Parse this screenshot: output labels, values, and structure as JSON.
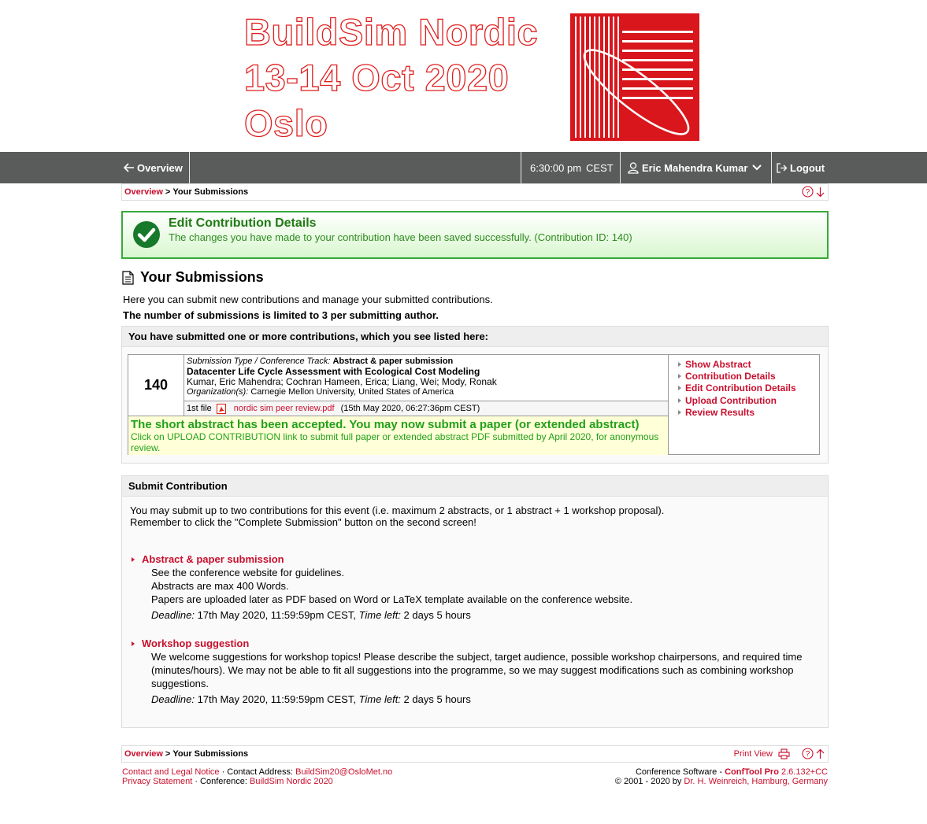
{
  "banner": {
    "lines": [
      "BuildSim Nordic",
      "13-14 Oct 2020",
      "Oslo"
    ]
  },
  "nav": {
    "overview": "Overview",
    "time": "6:30:00 pm",
    "tz": "CEST",
    "user": "Eric Mahendra Kumar",
    "logout": "Logout"
  },
  "breadcrumb": {
    "home": "Overview",
    "sep": ">",
    "current": "Your Submissions"
  },
  "success": {
    "title": "Edit Contribution Details",
    "message": "The changes you have made to your contribution have been saved successfully. (Contribution ID: 140)"
  },
  "page": {
    "title": "Your Submissions",
    "intro": "Here you can submit new contributions and manage your submitted contributions.",
    "limit": "The number of submissions is limited to 3 per submitting author."
  },
  "submissions": {
    "header": "You have submitted one or more contributions, which you see listed here:",
    "item": {
      "id": "140",
      "type_label": "Submission Type / Conference Track:",
      "type_value": "Abstract & paper submission",
      "title": "Datacenter Life Cycle Assessment with Ecological Cost Modeling",
      "authors": "Kumar, Eric Mahendra; Cochran Hameen, Erica; Liang, Wei; Mody, Ronak",
      "org_label": "Organization(s):",
      "org_value": "Carnegie Mellon University, United States of America",
      "file_label": "1st file",
      "file_name": "nordic sim peer review.pdf",
      "file_date": "(15th May 2020, 06:27:36pm CEST)",
      "status_main": "The short abstract has been accepted. You may now submit a paper (or extended abstract)",
      "status_note": "Click on UPLOAD CONTRIBUTION link to submit full paper or extended abstract PDF submitted by April 2020, for anonymous review.",
      "actions": [
        "Show Abstract",
        "Contribution Details",
        "Edit Contribution Details",
        "Upload Contribution",
        "Review Results"
      ]
    }
  },
  "submit": {
    "header": "Submit Contribution",
    "line1": "You may submit up to two contributions for this event (i.e. maximum 2 abstracts, or 1 abstract + 1 workshop proposal).",
    "line2": "Remember to click the \"Complete Submission\" button on the second screen!",
    "deadline_label": "Deadline:",
    "timeleft_label": "Time left:",
    "options": [
      {
        "title": "Abstract & paper submission",
        "desc": [
          "See the conference website for guidelines.",
          "Abstracts are max 400 Words.",
          "Papers are uploaded later as PDF based on Word or LaTeX template available on the conference website."
        ],
        "deadline": "17th May 2020, 11:59:59pm CEST,",
        "timeleft": "2 days 5 hours"
      },
      {
        "title": "Workshop suggestion",
        "desc": [
          "We welcome suggestions for workshop topics! Please describe the subject, target audience, possible workshop chairpersons, and required time",
          "(minutes/hours). We may not be able to fit all suggestions into the programme, so we may suggest modifications such as combining workshop",
          "suggestions."
        ],
        "deadline": "17th May 2020, 11:59:59pm CEST,",
        "timeleft": "2 days 5 hours"
      }
    ]
  },
  "bottom_bar": {
    "print": "Print View"
  },
  "footer": {
    "contact_link": "Contact and Legal Notice",
    "contact_sep": " · Contact Address: ",
    "contact_email": "BuildSim20@OsloMet.no",
    "privacy": "Privacy Statement",
    "conf_sep": " · Conference: ",
    "conf_name": "BuildSim Nordic 2020",
    "software_label": "Conference Software - ",
    "software_name": "ConfTool Pro",
    "software_version": "2.6.132+CC",
    "copyright": "© 2001 - 2020 by ",
    "author": "Dr. H. Weinreich, Hamburg, Germany"
  }
}
